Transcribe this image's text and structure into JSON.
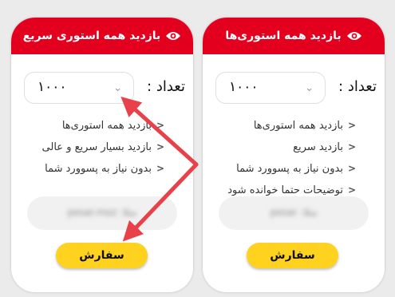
{
  "cards": [
    {
      "title": "بازدید همه استوری سریع",
      "icon": "eye-icon",
      "quantity_label": "تعداد :",
      "quantity_value": "۱۰۰۰",
      "features": [
        "بازدید همه استوری‌ها",
        "بازدید بسیار سریع و عالی",
        "بدون نیاز به پسوورد شما"
      ],
      "link_placeholder_blurred": "مثلا: pesar.moz",
      "order_label": "سفارش"
    },
    {
      "title": "بازدید همه استوری‌ها",
      "icon": "eye-icon",
      "quantity_label": "تعداد :",
      "quantity_value": "۱۰۰۰",
      "features": [
        "بازدید همه استوری‌ها",
        "بازدید سریع",
        "بدون نیاز به پسوورد شما",
        "توضیحات حتما خوانده شود"
      ],
      "link_placeholder_blurred": "مثلا: pesar",
      "order_label": "سفارش"
    }
  ],
  "colors": {
    "header_red": "#e3001f",
    "button_yellow": "#ffd21f",
    "arrow_red": "#e8414a",
    "background": "#ebebeb"
  }
}
